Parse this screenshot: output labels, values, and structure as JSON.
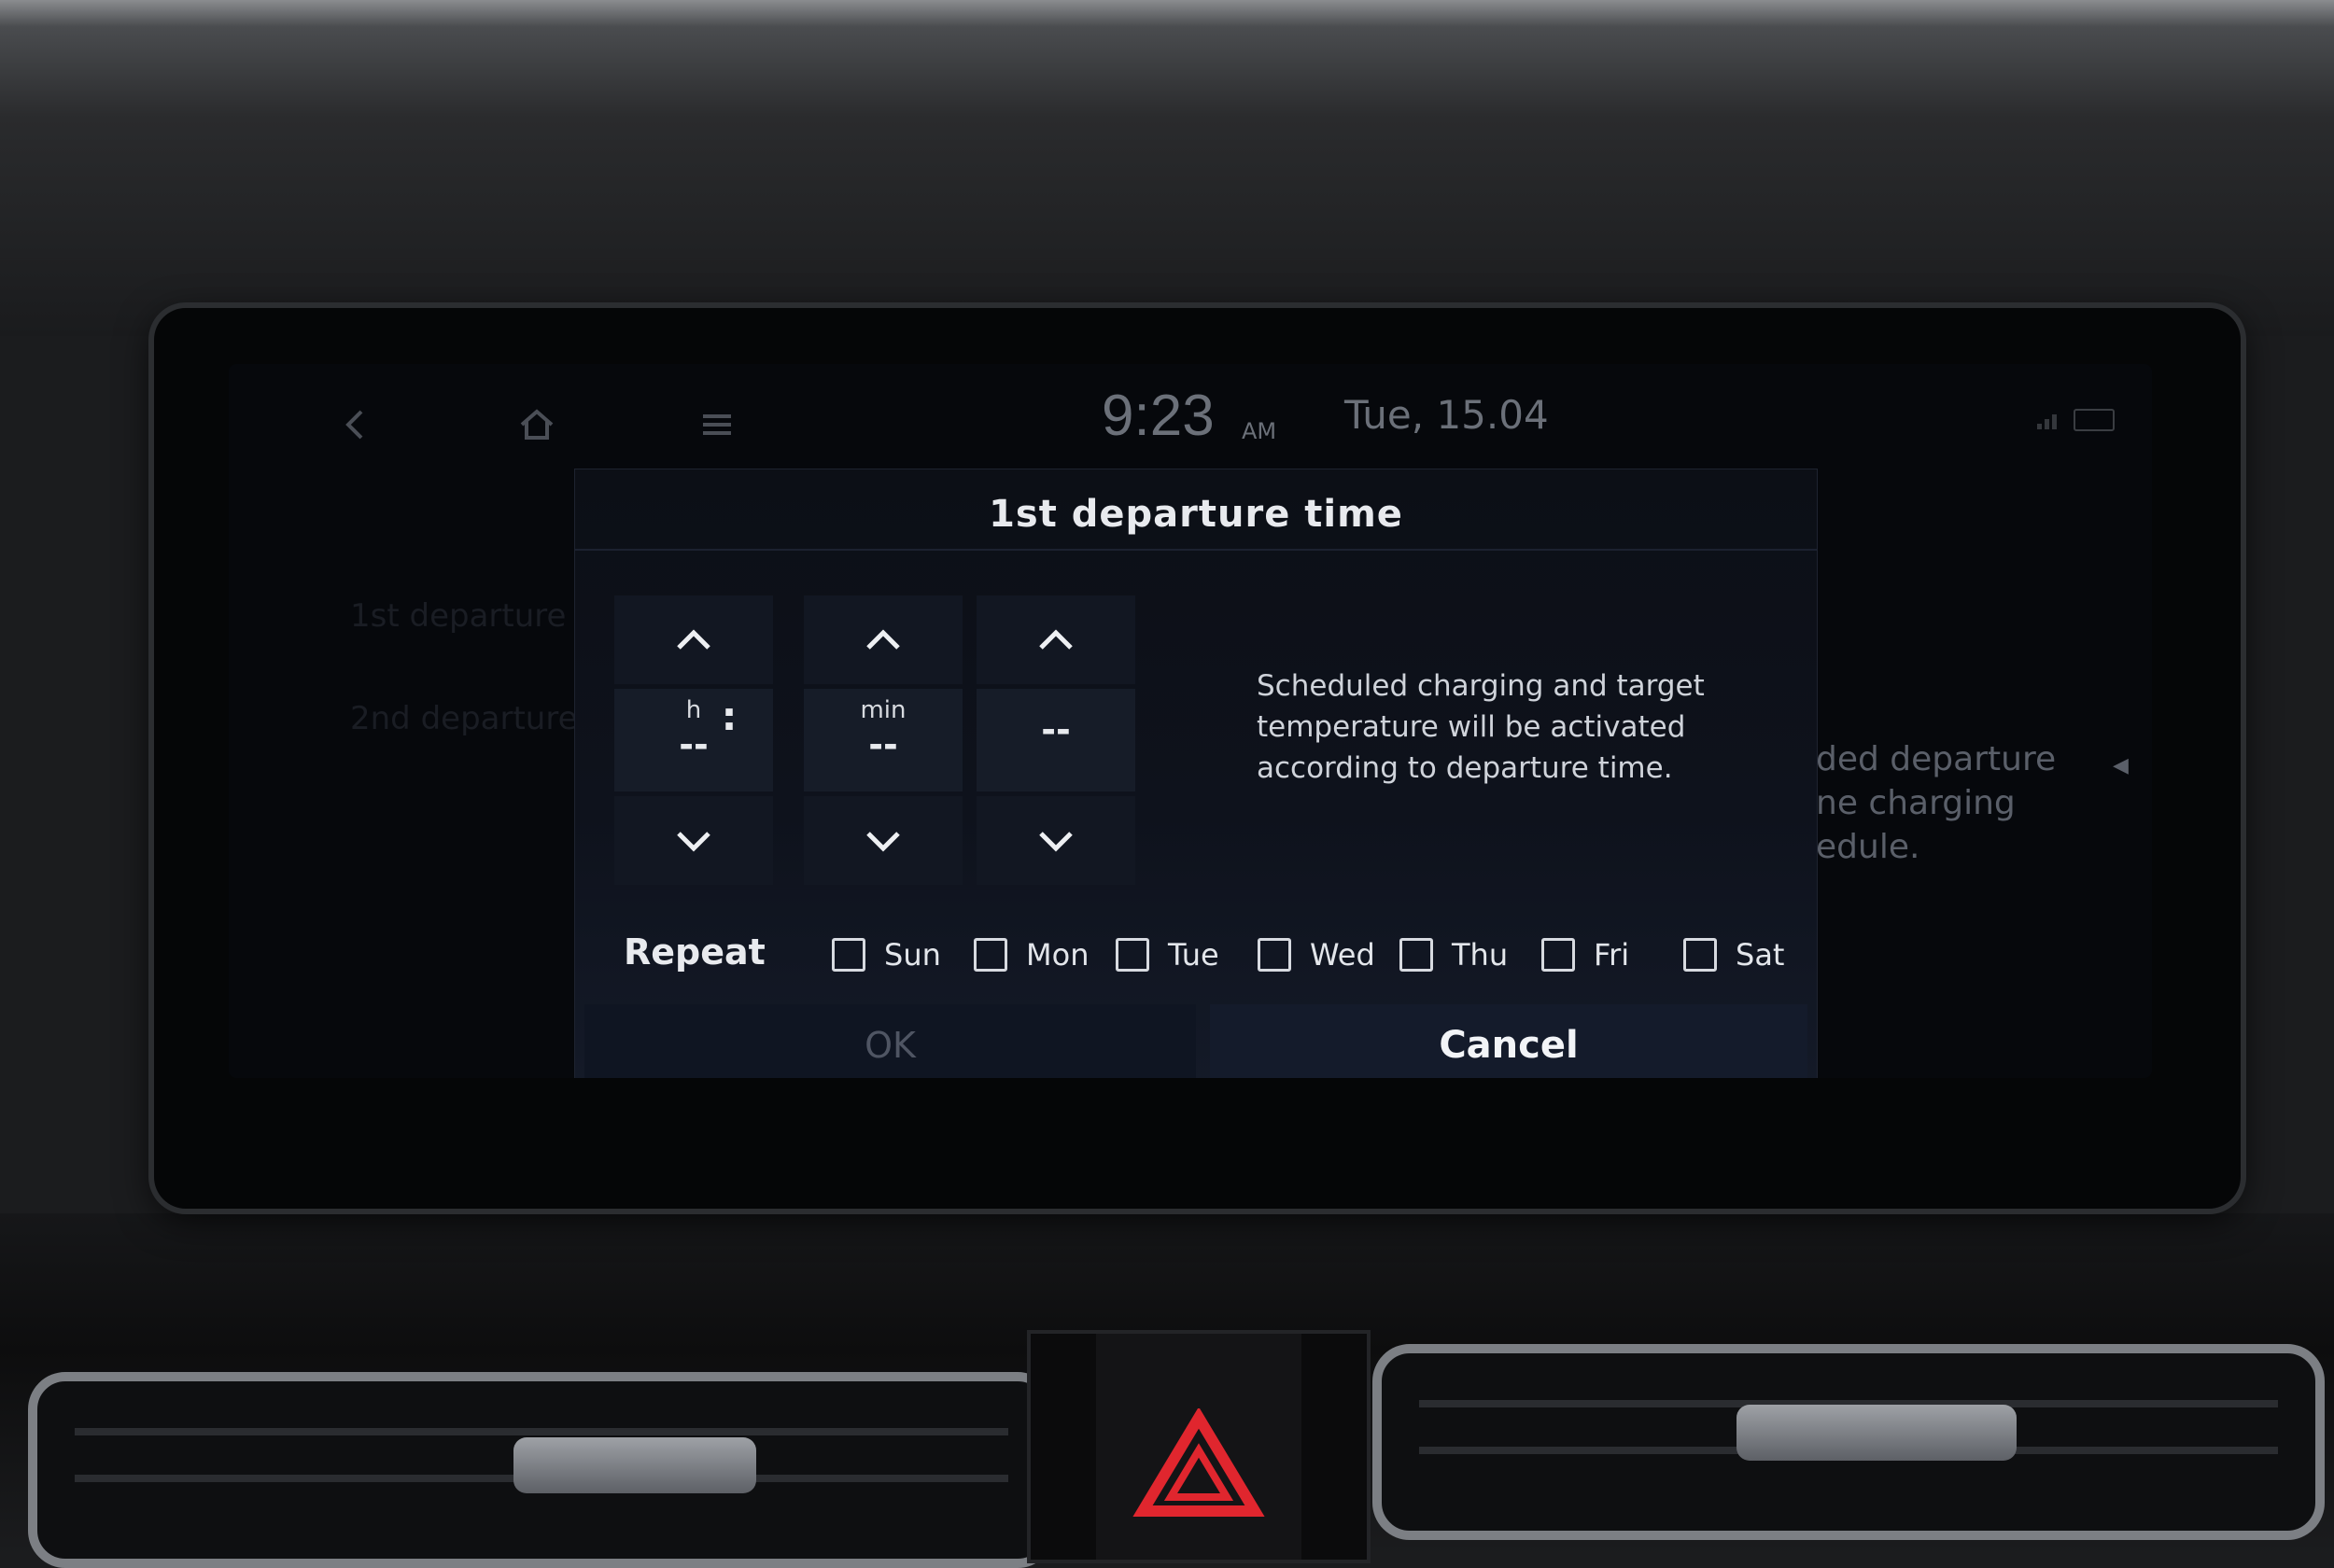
{
  "status_bar": {
    "time": "9:23",
    "ampm": "AM",
    "date": "Tue, 15.04",
    "icons": [
      "back-icon",
      "home-icon",
      "menu-icon",
      "signal-icon",
      "battery-icon"
    ]
  },
  "background": {
    "items": [
      "1st departure",
      "2nd departure"
    ],
    "description_lines": [
      "ded departure",
      "ne charging",
      "edule."
    ]
  },
  "dialog": {
    "title": "1st departure time",
    "hour": {
      "label": "h",
      "value": "--"
    },
    "minute": {
      "label": "min",
      "value": "--"
    },
    "period": {
      "value": "--"
    },
    "colon": ":",
    "info": "Scheduled charging and target temperature will be activated according to departure time.",
    "repeat_label": "Repeat",
    "days": [
      {
        "label": "Sun",
        "checked": false
      },
      {
        "label": "Mon",
        "checked": false
      },
      {
        "label": "Tue",
        "checked": false
      },
      {
        "label": "Wed",
        "checked": false
      },
      {
        "label": "Thu",
        "checked": false
      },
      {
        "label": "Fri",
        "checked": false
      },
      {
        "label": "Sat",
        "checked": false
      }
    ],
    "ok_label": "OK",
    "cancel_label": "Cancel"
  },
  "colors": {
    "dialog_bg": "#0e121c",
    "text": "#e8eaee",
    "ok_disabled": "#4f5563",
    "status_text": "#6b7079",
    "hazard": "#e0262e"
  }
}
